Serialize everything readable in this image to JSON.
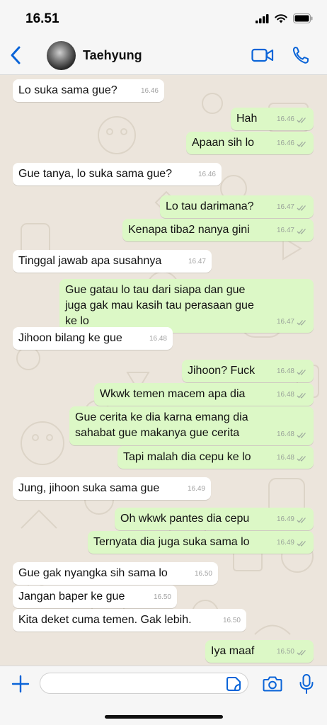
{
  "status_bar": {
    "time": "16.51"
  },
  "header": {
    "contact_name": "Taehyung"
  },
  "colors": {
    "accent": "#0a64d8",
    "outgoing_bubble": "#dcf8c6",
    "incoming_bubble": "#ffffff",
    "chat_background": "#ece5dc"
  },
  "icons": {
    "back": "chevron-left-icon",
    "video": "video-camera-icon",
    "call": "phone-icon",
    "plus": "plus-icon",
    "sticker": "sticker-icon",
    "camera": "camera-icon",
    "mic": "microphone-icon"
  },
  "messages": [
    {
      "dir": "in",
      "text": "Lo suka sama gue?",
      "time": "16.46"
    },
    {
      "dir": "out",
      "text": "Hah",
      "time": "16.46"
    },
    {
      "dir": "out",
      "text": "Apaan sih lo",
      "time": "16.46"
    },
    {
      "dir": "in",
      "text": "Gue tanya, lo suka sama gue?",
      "time": "16.46"
    },
    {
      "dir": "out",
      "text": "Lo tau darimana?",
      "time": "16.47"
    },
    {
      "dir": "out",
      "text": "Kenapa tiba2 nanya gini",
      "time": "16.47"
    },
    {
      "dir": "in",
      "text": "Tinggal jawab apa susahnya",
      "time": "16.47"
    },
    {
      "dir": "out",
      "text": "Gue gatau lo tau dari siapa dan gue juga gak mau kasih tau perasaan gue ke lo",
      "time": "16.47"
    },
    {
      "dir": "in",
      "text": "Jihoon bilang ke gue",
      "time": "16.48"
    },
    {
      "dir": "out",
      "text": "Jihoon? Fuck",
      "time": "16.48"
    },
    {
      "dir": "out",
      "text": "Wkwk temen macem apa dia",
      "time": "16.48"
    },
    {
      "dir": "out",
      "text": "Gue cerita ke dia karna emang dia sahabat gue makanya gue cerita",
      "time": "16.48"
    },
    {
      "dir": "out",
      "text": "Tapi malah dia cepu ke lo",
      "time": "16.48"
    },
    {
      "dir": "in",
      "text": "Jung, jihoon suka sama gue",
      "time": "16.49"
    },
    {
      "dir": "out",
      "text": "Oh wkwk pantes dia cepu",
      "time": "16.49"
    },
    {
      "dir": "out",
      "text": "Ternyata dia juga suka sama lo",
      "time": "16.49"
    },
    {
      "dir": "in",
      "text": "Gue gak nyangka sih sama lo",
      "time": "16.50"
    },
    {
      "dir": "in",
      "text": "Jangan baper ke gue",
      "time": "16.50"
    },
    {
      "dir": "in",
      "text": "Kita deket cuma temen. Gak lebih.",
      "time": "16.50"
    },
    {
      "dir": "out",
      "text": "Iya maaf",
      "time": "16.50"
    }
  ],
  "composer": {
    "value": "",
    "placeholder": ""
  }
}
